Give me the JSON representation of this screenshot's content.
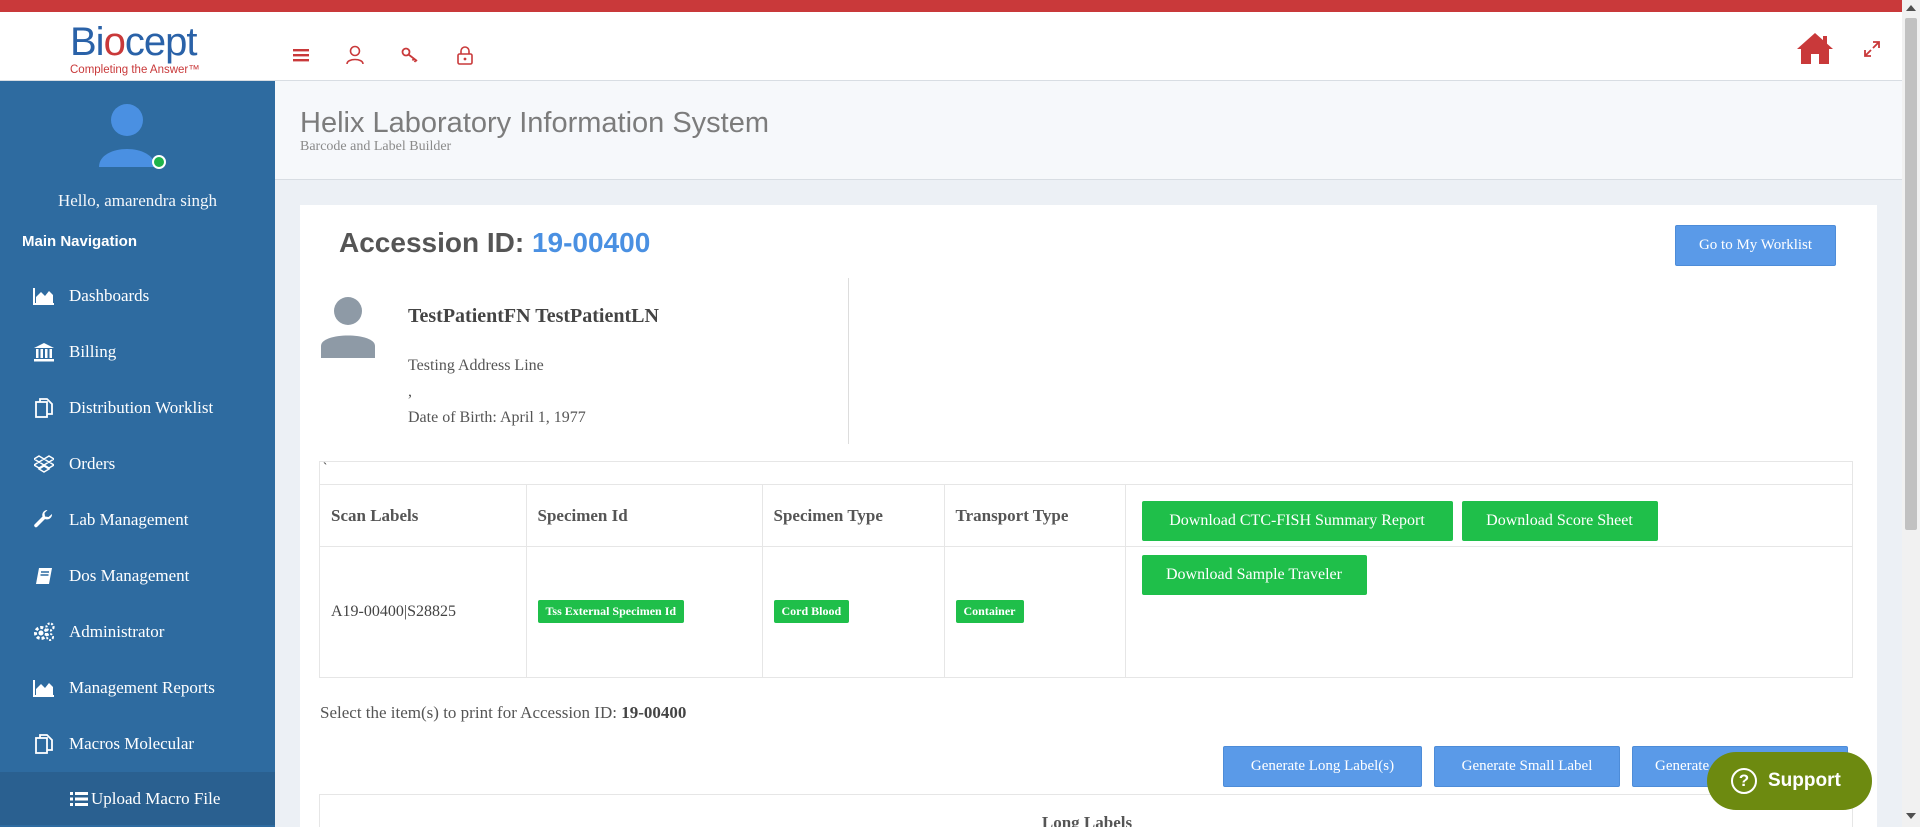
{
  "colors": {
    "accent_red": "#c9393a",
    "brand_blue": "#2a62a8",
    "sidebar_bg": "#2e6ba0",
    "button_blue": "#5a9ae8",
    "button_green": "#1fbf4a",
    "support_bg": "#6d8a10"
  },
  "logo": {
    "word_left": "Bi",
    "word_o": "o",
    "word_right": "cept",
    "tagline": "Completing the Answer™"
  },
  "header": {
    "icons": [
      "menu-icon",
      "user-icon",
      "key-icon",
      "lock-icon",
      "home-icon",
      "expand-icon"
    ]
  },
  "sidebar": {
    "greeting": "Hello, amarendra singh",
    "section_title": "Main Navigation",
    "items": [
      {
        "label": "Dashboards",
        "icon": "area-chart-icon"
      },
      {
        "label": "Billing",
        "icon": "bank-icon"
      },
      {
        "label": "Distribution Worklist",
        "icon": "copy-icon"
      },
      {
        "label": "Orders",
        "icon": "dropbox-icon"
      },
      {
        "label": "Lab Management",
        "icon": "wrench-icon"
      },
      {
        "label": "Dos Management",
        "icon": "book-icon"
      },
      {
        "label": "Administrator",
        "icon": "cogs-icon"
      },
      {
        "label": "Management Reports",
        "icon": "area-chart-icon"
      },
      {
        "label": "Macros Molecular",
        "icon": "copy-icon"
      }
    ],
    "sub_item": {
      "label": "Upload Macro File",
      "icon": "list-icon"
    }
  },
  "page": {
    "title": "Helix Laboratory Information System",
    "subtitle": "Barcode and Label Builder"
  },
  "accession": {
    "label": "Accession ID: ",
    "value": "19-00400"
  },
  "worklist_button": "Go to My Worklist",
  "patient": {
    "name": "TestPatientFN TestPatientLN",
    "address": "Testing Address Line",
    "city_line": ",",
    "dob": "Date of Birth: April 1, 1977"
  },
  "table": {
    "stray_char": "`",
    "headers": [
      "Scan Labels",
      "Specimen Id",
      "Specimen Type",
      "Transport Type",
      ""
    ],
    "row": {
      "scan_label": "A19-00400|S28825",
      "specimen_id": "Tss External Specimen Id",
      "specimen_type": "Cord Blood",
      "transport_type": "Container"
    },
    "actions": [
      "Download CTC-FISH Summary Report",
      "Download Score Sheet",
      "Download Sample Traveler"
    ]
  },
  "select_prompt": {
    "text": "Select the item(s) to print for Accession ID: ",
    "value": "19-00400"
  },
  "generate_buttons": [
    "Generate Long Label(s)",
    "Generate Small Label",
    "Generate"
  ],
  "long_labels_title": "Long Labels",
  "support": {
    "label": "Support",
    "glyph": "?"
  }
}
